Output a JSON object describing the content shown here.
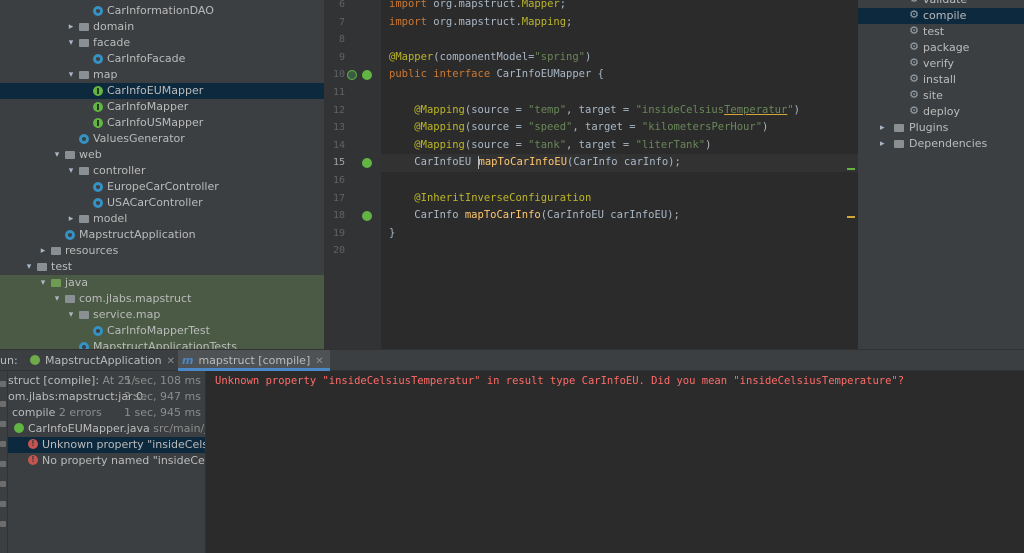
{
  "project_tree": [
    {
      "label": "CarInformationDAO",
      "icon": "class",
      "indent": 3,
      "arrow": ""
    },
    {
      "label": "domain",
      "icon": "folder",
      "indent": 2,
      "arrow": ">"
    },
    {
      "label": "facade",
      "icon": "folder",
      "indent": 2,
      "arrow": "v"
    },
    {
      "label": "CarInfoFacade",
      "icon": "class",
      "indent": 3,
      "arrow": ""
    },
    {
      "label": "map",
      "icon": "folder",
      "indent": 2,
      "arrow": "v"
    },
    {
      "label": "CarInfoEUMapper",
      "icon": "interface",
      "indent": 3,
      "arrow": "",
      "selected": true
    },
    {
      "label": "CarInfoMapper",
      "icon": "interface",
      "indent": 3,
      "arrow": ""
    },
    {
      "label": "CarInfoUSMapper",
      "icon": "interface",
      "indent": 3,
      "arrow": ""
    },
    {
      "label": "ValuesGenerator",
      "icon": "class",
      "indent": 2,
      "arrow": ""
    },
    {
      "label": "web",
      "icon": "folder",
      "indent": 1,
      "arrow": "v"
    },
    {
      "label": "controller",
      "icon": "folder",
      "indent": 2,
      "arrow": "v"
    },
    {
      "label": "EuropeCarController",
      "icon": "class",
      "indent": 3,
      "arrow": ""
    },
    {
      "label": "USACarController",
      "icon": "class",
      "indent": 3,
      "arrow": ""
    },
    {
      "label": "model",
      "icon": "folder",
      "indent": 2,
      "arrow": ">"
    },
    {
      "label": "MapstructApplication",
      "icon": "class",
      "indent": 1,
      "arrow": ""
    },
    {
      "label": "resources",
      "icon": "folder",
      "indent": 0,
      "arrow": ">"
    },
    {
      "label": "test",
      "icon": "folder",
      "indent": -1,
      "arrow": "v"
    },
    {
      "label": "java",
      "icon": "folder-green",
      "indent": 0,
      "arrow": "v",
      "green": true
    },
    {
      "label": "com.jlabs.mapstruct",
      "icon": "folder",
      "indent": 1,
      "arrow": "v",
      "green": true
    },
    {
      "label": "service.map",
      "icon": "folder",
      "indent": 2,
      "arrow": "v",
      "green": true
    },
    {
      "label": "CarInfoMapperTest",
      "icon": "class",
      "indent": 3,
      "arrow": "",
      "green": true
    },
    {
      "label": "MapstructApplicationTests",
      "icon": "class",
      "indent": 2,
      "arrow": "",
      "green": true
    }
  ],
  "editor": {
    "line_numbers": [
      "6",
      "7",
      "8",
      "9",
      "10",
      "11",
      "12",
      "13",
      "14",
      "15",
      "16",
      "17",
      "18",
      "19",
      "20"
    ],
    "current_line": "15",
    "lines": [
      {
        "ln": "6",
        "tokens": [
          [
            "kw",
            "import "
          ],
          [
            "",
            "org.mapstruct."
          ],
          [
            "ann",
            "Mapper"
          ],
          [
            "",
            ";"
          ]
        ]
      },
      {
        "ln": "7",
        "tokens": [
          [
            "kw",
            "import "
          ],
          [
            "",
            "org.mapstruct."
          ],
          [
            "ann",
            "Mapping"
          ],
          [
            "",
            ";"
          ]
        ]
      },
      {
        "ln": "8",
        "tokens": []
      },
      {
        "ln": "9",
        "tokens": [
          [
            "ann",
            "@Mapper"
          ],
          [
            "",
            "(componentModel="
          ],
          [
            "str",
            "\"spring\""
          ],
          [
            "",
            ")"
          ]
        ]
      },
      {
        "ln": "10",
        "tokens": [
          [
            "kw",
            "public interface "
          ],
          [
            "",
            "CarInfoEUMapper {"
          ]
        ]
      },
      {
        "ln": "11",
        "tokens": []
      },
      {
        "ln": "12",
        "tokens": [
          [
            "",
            "    "
          ],
          [
            "ann",
            "@Mapping"
          ],
          [
            "",
            "(source = "
          ],
          [
            "str",
            "\"temp\""
          ],
          [
            "",
            ", target = "
          ],
          [
            "str",
            "\"insideCelsius"
          ],
          [
            "str squig",
            "Temperatur"
          ],
          [
            "str",
            "\""
          ],
          [
            "",
            ")"
          ]
        ]
      },
      {
        "ln": "13",
        "tokens": [
          [
            "",
            "    "
          ],
          [
            "ann",
            "@Mapping"
          ],
          [
            "",
            "(source = "
          ],
          [
            "str",
            "\"speed\""
          ],
          [
            "",
            ", target = "
          ],
          [
            "str",
            "\"kilometersPerHour\""
          ],
          [
            "",
            ")"
          ]
        ]
      },
      {
        "ln": "14",
        "tokens": [
          [
            "",
            "    "
          ],
          [
            "ann",
            "@Mapping"
          ],
          [
            "",
            "(source = "
          ],
          [
            "str",
            "\"tank\""
          ],
          [
            "",
            ", target = "
          ],
          [
            "str",
            "\"literTank\""
          ],
          [
            "",
            ")"
          ]
        ]
      },
      {
        "ln": "15",
        "tokens": [
          [
            "",
            "    CarInfoEU "
          ],
          [
            "caret",
            ""
          ],
          [
            "fn",
            "mapToCarInfoEU"
          ],
          [
            "",
            "(CarInfo carInfo);"
          ]
        ]
      },
      {
        "ln": "16",
        "tokens": []
      },
      {
        "ln": "17",
        "tokens": [
          [
            "",
            "    "
          ],
          [
            "ann",
            "@InheritInverseConfiguration"
          ]
        ]
      },
      {
        "ln": "18",
        "tokens": [
          [
            "",
            "    CarInfo "
          ],
          [
            "fn",
            "mapToCarInfo"
          ],
          [
            "",
            "(CarInfoEU carInfoEU);"
          ]
        ]
      },
      {
        "ln": "19",
        "tokens": [
          [
            "",
            "}"
          ]
        ]
      },
      {
        "ln": "20",
        "tokens": []
      }
    ]
  },
  "maven_panel": [
    {
      "label": "validate"
    },
    {
      "label": "compile",
      "selected": true
    },
    {
      "label": "test"
    },
    {
      "label": "package"
    },
    {
      "label": "verify"
    },
    {
      "label": "install"
    },
    {
      "label": "site"
    },
    {
      "label": "deploy"
    },
    {
      "label": "Plugins",
      "folder": true,
      "arrow": ">"
    },
    {
      "label": "Dependencies",
      "folder": true,
      "arrow": ">"
    }
  ],
  "run_window": {
    "run_label": "un:",
    "tabs": [
      {
        "label": "MapstructApplication",
        "icon": "spring-boot-icon"
      },
      {
        "label": "mapstruct [compile]",
        "icon": "maven-icon",
        "active": true
      }
    ],
    "tree": [
      {
        "text": "struct [compile]:",
        "muted": " At 21/",
        "time": "5 sec, 108 ms",
        "icon": "warn"
      },
      {
        "text": "om.jlabs:mapstruct:jar:0.",
        "time": "2 sec, 947 ms",
        "icon": ""
      },
      {
        "text": "compile",
        "muted": "  2 errors",
        "time": "1 sec, 945 ms",
        "icon": ""
      },
      {
        "text": "CarInfoEUMapper.java",
        "muted": " src/main/jav",
        "icon": "interface"
      },
      {
        "text": "Unknown property \"insideCelsiu",
        "icon": "error",
        "selected": true
      },
      {
        "text": "No property named \"insideCelsi",
        "icon": "error"
      }
    ],
    "output": "Unknown property \"insideCelsiusTemperatur\" in result type CarInfoEU. Did you mean \"insideCelsiusTemperature\"?"
  }
}
